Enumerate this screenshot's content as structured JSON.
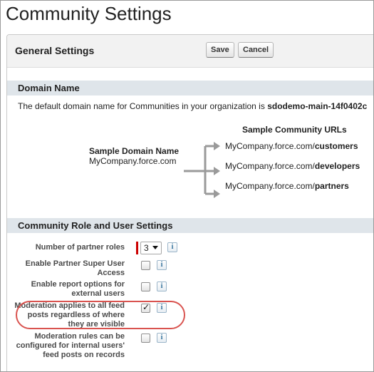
{
  "page": {
    "title": "Community Settings"
  },
  "general": {
    "title": "General Settings",
    "save_label": "Save",
    "cancel_label": "Cancel"
  },
  "domain": {
    "section_title": "Domain Name",
    "description": "The default domain name for Communities in your organization is ",
    "value": "sdodemo-main-14f0402c",
    "urls_heading": "Sample Community URLs",
    "sample_label": "Sample Domain Name",
    "sample_value": "MyCompany.force.com",
    "urls": [
      {
        "prefix": "MyCompany.force.com/",
        "suffix": "customers"
      },
      {
        "prefix": "MyCompany.force.com/",
        "suffix": "developers"
      },
      {
        "prefix": "MyCompany.force.com/",
        "suffix": "partners"
      }
    ]
  },
  "roles": {
    "section_title": "Community Role and User Settings",
    "rows": [
      {
        "label": "Number of partner roles",
        "value": "3",
        "info": "i"
      },
      {
        "label": "Enable Partner Super User Access",
        "checked": false,
        "info": "i"
      },
      {
        "label": "Enable report options for external users",
        "checked": false,
        "info": "i"
      },
      {
        "label": "Moderation applies to all feed posts regardless of where they are visible",
        "checked": true,
        "info": "i"
      },
      {
        "label": "Moderation rules can be configured for internal users' feed posts on records",
        "checked": false,
        "info": "i"
      }
    ]
  }
}
